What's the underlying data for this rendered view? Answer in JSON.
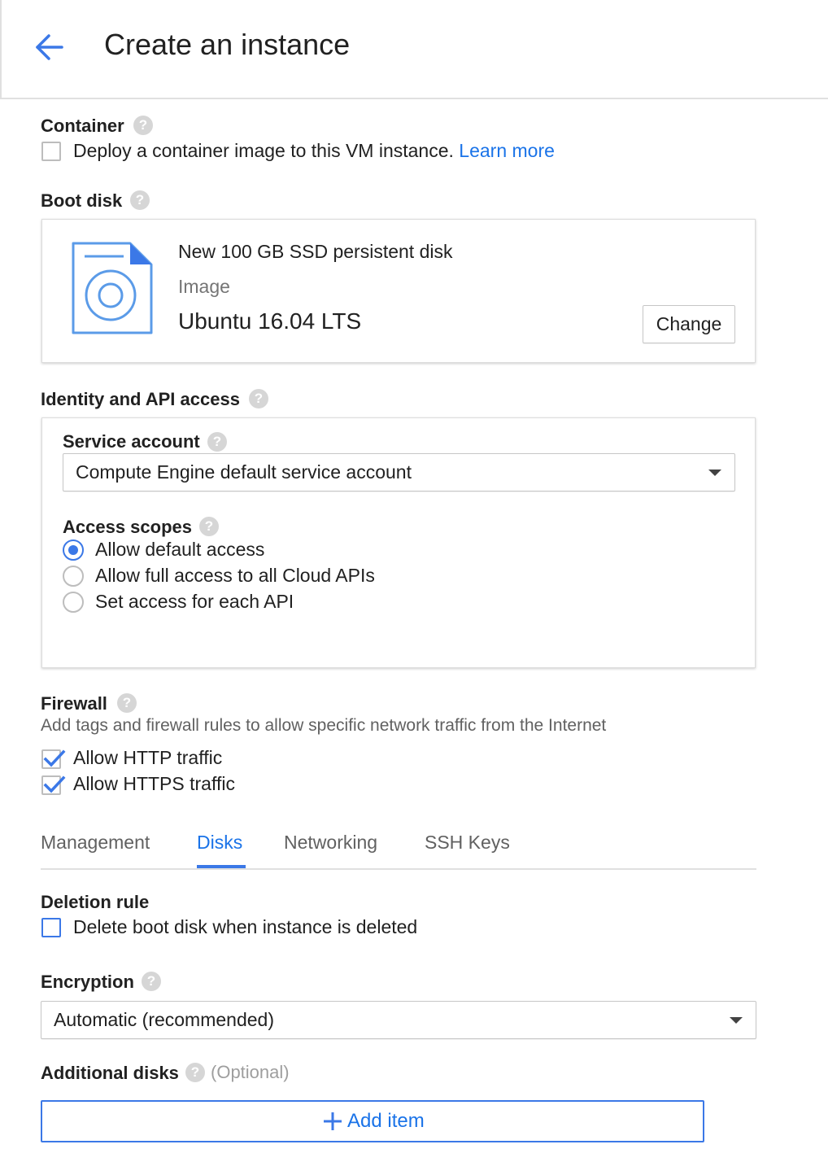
{
  "header": {
    "title": "Create an instance",
    "back_icon": "arrow-left-icon"
  },
  "colors": {
    "accent": "#1a73e8",
    "checkbox_blue": "#3b78e7",
    "help_gray": "#d6d6d6"
  },
  "container": {
    "label": "Container",
    "checkbox_label": "Deploy a container image to this VM instance.",
    "learn_more": "Learn more",
    "checked": false
  },
  "boot_disk": {
    "label": "Boot disk",
    "disk_title": "New 100 GB SSD persistent disk",
    "image_label": "Image",
    "image_name": "Ubuntu 16.04 LTS",
    "change_button": "Change",
    "icon": "disk-image-icon"
  },
  "identity": {
    "label": "Identity and API access",
    "service_account_label": "Service account",
    "service_account_value": "Compute Engine default service account",
    "access_scopes_label": "Access scopes",
    "scopes": [
      {
        "label": "Allow default access",
        "selected": true
      },
      {
        "label": "Allow full access to all Cloud APIs",
        "selected": false
      },
      {
        "label": "Set access for each API",
        "selected": false
      }
    ]
  },
  "firewall": {
    "label": "Firewall",
    "description": "Add tags and firewall rules to allow specific network traffic from the Internet",
    "options": [
      {
        "label": "Allow HTTP traffic",
        "checked": true
      },
      {
        "label": "Allow HTTPS traffic",
        "checked": true
      }
    ]
  },
  "tabs": [
    {
      "label": "Management",
      "active": false
    },
    {
      "label": "Disks",
      "active": true
    },
    {
      "label": "Networking",
      "active": false
    },
    {
      "label": "SSH Keys",
      "active": false
    }
  ],
  "disks": {
    "deletion_rule_label": "Deletion rule",
    "delete_boot_disk_label": "Delete boot disk when instance is deleted",
    "delete_boot_disk_checked": false,
    "encryption_label": "Encryption",
    "encryption_value": "Automatic (recommended)",
    "additional_disks_label": "Additional disks",
    "optional_label": "(Optional)",
    "add_item_label": "Add item"
  }
}
